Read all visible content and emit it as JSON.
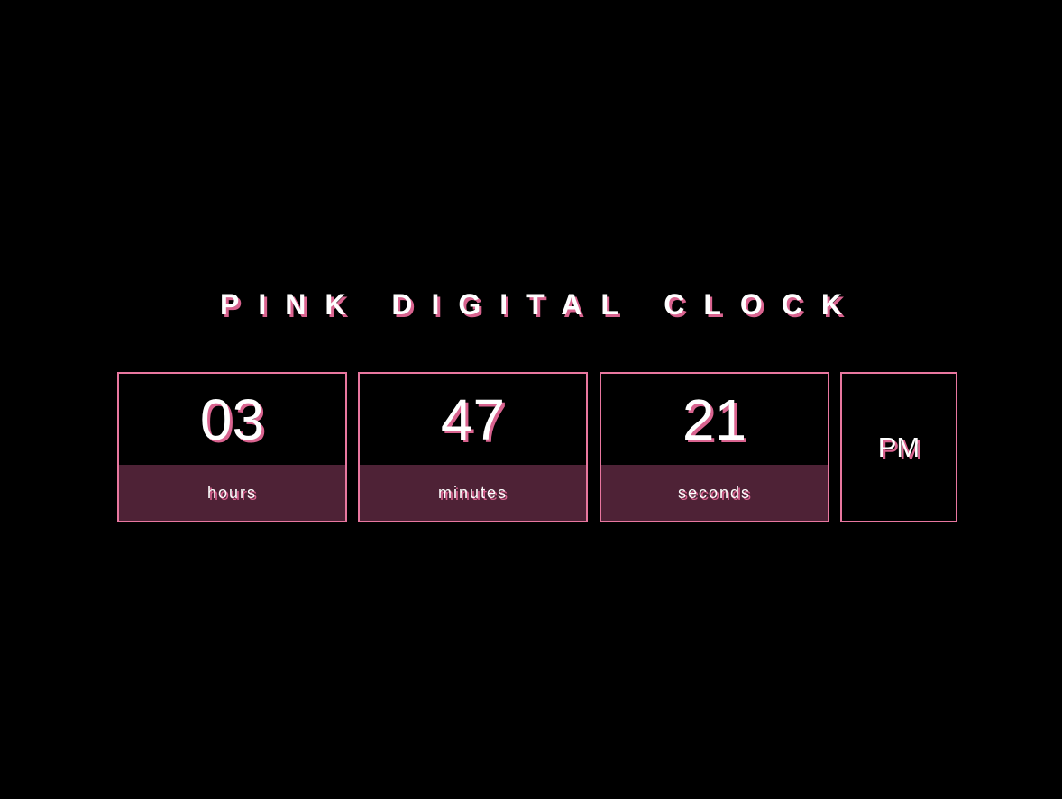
{
  "title": "PINK DIGITAL CLOCK",
  "clock": {
    "hours": {
      "value": "03",
      "label": "hours"
    },
    "minutes": {
      "value": "47",
      "label": "minutes"
    },
    "seconds": {
      "value": "21",
      "label": "seconds"
    },
    "period": "PM"
  },
  "colors": {
    "background": "#000000",
    "border": "#e8779f",
    "label_background": "#4e2236",
    "text": "#ffffff",
    "text_shadow": "#d9638f"
  }
}
